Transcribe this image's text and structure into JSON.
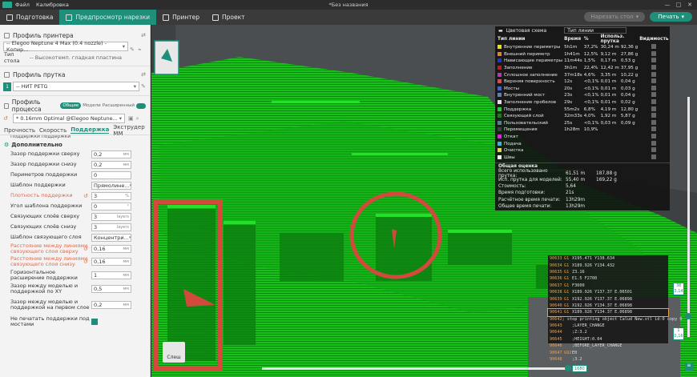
{
  "window": {
    "menu_file": "Файл",
    "menu_calibration": "Калибровка",
    "title": "*Без названия",
    "min": "—",
    "max": "□",
    "close": "✕"
  },
  "tabs": [
    {
      "label": "Подготовка"
    },
    {
      "label": "Предпросмотр нарезки"
    },
    {
      "label": "Принтер"
    },
    {
      "label": "Проект"
    }
  ],
  "actions": {
    "slice_label": "Нарезать стол",
    "print_label": "Печать"
  },
  "left": {
    "printer_profile_title": "Профиль принтера",
    "printer_value": "-- Elegoo Neptune 4 Max (0.4 nozzle) - Копир...",
    "table_type_label": "Тип стола",
    "table_type_value": "-- Высокотемп. гладкая пластина",
    "filament_title": "Профиль прутка",
    "filament_index": "1",
    "filament_value": "-- НИТ PETG",
    "process_title": "Профиль процесса",
    "mode_general": "Общие",
    "mode_models": "Модели",
    "mode_advanced": "Расширенный",
    "process_value": "* 0.16mm Optimal @Elegoo Neptune...",
    "subtabs": [
      "Прочность",
      "Скорость",
      "Поддержка",
      "Экструдер ММ"
    ],
    "cut_text": "Поддержки поддержки",
    "advanced_title": "Дополнительно",
    "params": [
      {
        "label": "Зазор поддержки сверху",
        "value": "0,2",
        "unit": "мм"
      },
      {
        "label": "Зазор поддержки снизу",
        "value": "0,2",
        "unit": "мм"
      },
      {
        "label": "Периметров поддержки",
        "value": "0",
        "unit": ""
      },
      {
        "label": "Шаблон поддержки",
        "value": "Прямолине...",
        "unit": ""
      },
      {
        "label": "Плотность поддержки",
        "value": "3",
        "unit": "%"
      },
      {
        "label": "Угол шаблона поддержки",
        "value": "0",
        "unit": "°"
      },
      {
        "label": "Связующих слоёв сверху",
        "value": "3",
        "unit": "layers"
      },
      {
        "label": "Связующих слоёв снизу",
        "value": "3",
        "unit": "layers"
      },
      {
        "label": "Шаблон связующего слоя",
        "value": "Концентри...",
        "unit": ""
      },
      {
        "label": "Расстояние между линиями связующего слоя сверху",
        "value": "0,16",
        "unit": "мм"
      },
      {
        "label": "Расстояние между линиями связующего слоя снизу",
        "value": "0,16",
        "unit": "мм"
      },
      {
        "label": "Горизонтальное расширение поддержки",
        "value": "1",
        "unit": "мм"
      },
      {
        "label": "Зазор между моделью и поддержкой по XY",
        "value": "0,5",
        "unit": "мм"
      },
      {
        "label": "Зазор между моделью и поддержкой на первом слое",
        "value": "0,2",
        "unit": "мм"
      },
      {
        "label": "Не печатать поддержки под мостами",
        "value": "",
        "unit": ""
      }
    ]
  },
  "view": {
    "slices_btn": "Слеш",
    "layer_top_a": "38",
    "layer_top_b": "3,14",
    "layer_bottom_a": "1",
    "layer_bottom_b": "0,16",
    "hslider_value": "1680"
  },
  "legend": {
    "title": "Цветовая схема",
    "scheme_value": "Тип линии",
    "headers": [
      "Тип линии",
      "Время",
      "%",
      "Использ. прутка",
      "Видимость"
    ],
    "rows": [
      {
        "name": "Внутренние периметры",
        "time": "5h1m",
        "pct": "37,2%",
        "len": "30,24 m",
        "wt": "92,36 g",
        "color": "#e8e028"
      },
      {
        "name": "Внешний периметр",
        "time": "1h41m",
        "pct": "12,5%",
        "len": "9,12 m",
        "wt": "27,86 g",
        "color": "#e88028"
      },
      {
        "name": "Нависающие периметры",
        "time": "11m44s",
        "pct": "1,5%",
        "len": "0,17 m",
        "wt": "0,53 g",
        "color": "#2030e8"
      },
      {
        "name": "Заполнение",
        "time": "3h1m",
        "pct": "22,4%",
        "len": "12,42 m",
        "wt": "37,95 g",
        "color": "#b02020"
      },
      {
        "name": "Сплошное заполнение",
        "time": "37m18s",
        "pct": "4,6%",
        "len": "3,35 m",
        "wt": "10,22 g",
        "color": "#c030c0"
      },
      {
        "name": "Верхняя поверхность",
        "time": "12s",
        "pct": "<0,1%",
        "len": "0,01 m",
        "wt": "0,04 g",
        "color": "#f04040"
      },
      {
        "name": "Мосты",
        "time": "20s",
        "pct": "<0,1%",
        "len": "0,01 m",
        "wt": "0,03 g",
        "color": "#4060e0"
      },
      {
        "name": "Внутренний мост",
        "time": "23s",
        "pct": "<0,1%",
        "len": "0,01 m",
        "wt": "0,04 g",
        "color": "#6080b0"
      },
      {
        "name": "Заполнение пробелов",
        "time": "29s",
        "pct": "<0,1%",
        "len": "0,01 m",
        "wt": "0,02 g",
        "color": "#e0e0e0"
      },
      {
        "name": "Поддержка",
        "time": "55m2s",
        "pct": "6,8%",
        "len": "4,19 m",
        "wt": "12,80 g",
        "color": "#20d020"
      },
      {
        "name": "Связующий слой",
        "time": "32m33s",
        "pct": "4,0%",
        "len": "1,92 m",
        "wt": "5,87 g",
        "color": "#188018"
      },
      {
        "name": "Пользовательский",
        "time": "25s",
        "pct": "<0,1%",
        "len": "0,03 m",
        "wt": "0,09 g",
        "color": "#5080a0"
      },
      {
        "name": "Перемещения",
        "time": "1h28m",
        "pct": "10,9%",
        "len": "",
        "wt": "",
        "color": "#404040"
      },
      {
        "name": "Откат",
        "time": "",
        "pct": "",
        "len": "",
        "wt": "",
        "color": "#e020e0"
      },
      {
        "name": "Подача",
        "time": "",
        "pct": "",
        "len": "",
        "wt": "",
        "color": "#20c0e0"
      },
      {
        "name": "Очистка",
        "time": "",
        "pct": "",
        "len": "",
        "wt": "",
        "color": "#e0e020"
      },
      {
        "name": "Швы",
        "time": "",
        "pct": "",
        "len": "",
        "wt": "",
        "color": "#f0f0f0"
      }
    ],
    "estimate_title": "Общая оценка",
    "estimates": [
      {
        "label": "Всего использовано прутка:",
        "a": "61,51 m",
        "b": "187,88 g"
      },
      {
        "label": "Исп. прутка для моделей:",
        "a": "55,40 m",
        "b": "169,22 g"
      },
      {
        "label": "Стоимость:",
        "a": "5,64",
        "b": ""
      },
      {
        "label": "Время подготовки:",
        "a": "21s",
        "b": ""
      },
      {
        "label": "Расчётное время печати:",
        "a": "13h29m",
        "b": ""
      },
      {
        "label": "Общее время печати:",
        "a": "13h29m",
        "b": ""
      }
    ]
  },
  "gcode": [
    {
      "n": "90633",
      "k": "G1",
      "t": "X195.471 Y138.634"
    },
    {
      "n": "90634",
      "k": "G1",
      "t": "X189.926 Y134.432"
    },
    {
      "n": "90635",
      "k": "G1",
      "t": "Z3.16"
    },
    {
      "n": "90636",
      "k": "G1",
      "t": "E1.5 F2700"
    },
    {
      "n": "90637",
      "k": "G1",
      "t": "F3600"
    },
    {
      "n": "90638",
      "k": "G1",
      "t": "X189.926 Y137.37 E.06501"
    },
    {
      "n": "90639",
      "k": "G1",
      "t": "X192.926 Y137.37 E.06898"
    },
    {
      "n": "90640",
      "k": "G1",
      "t": "X192.926 Y134.37 E.06898"
    },
    {
      "n": "90641",
      "k": "G1",
      "t": "X189.926 Y134.37 E.06898"
    },
    {
      "n": "90642",
      "k": "",
      "t": "; stop printing object Calud New.stl id:0 copy 0"
    },
    {
      "n": "90643",
      "k": "",
      "t": ";LAYER_CHANGE"
    },
    {
      "n": "90644",
      "k": "",
      "t": ";Z:3.2"
    },
    {
      "n": "90645",
      "k": "",
      "t": ";HEIGHT:0.04"
    },
    {
      "n": "90646",
      "k": "",
      "t": ";BEFORE_LAYER_CHANGE"
    },
    {
      "n": "90647",
      "k": "G92",
      "t": "E0"
    },
    {
      "n": "90648",
      "k": "",
      "t": ";3.2"
    }
  ]
}
